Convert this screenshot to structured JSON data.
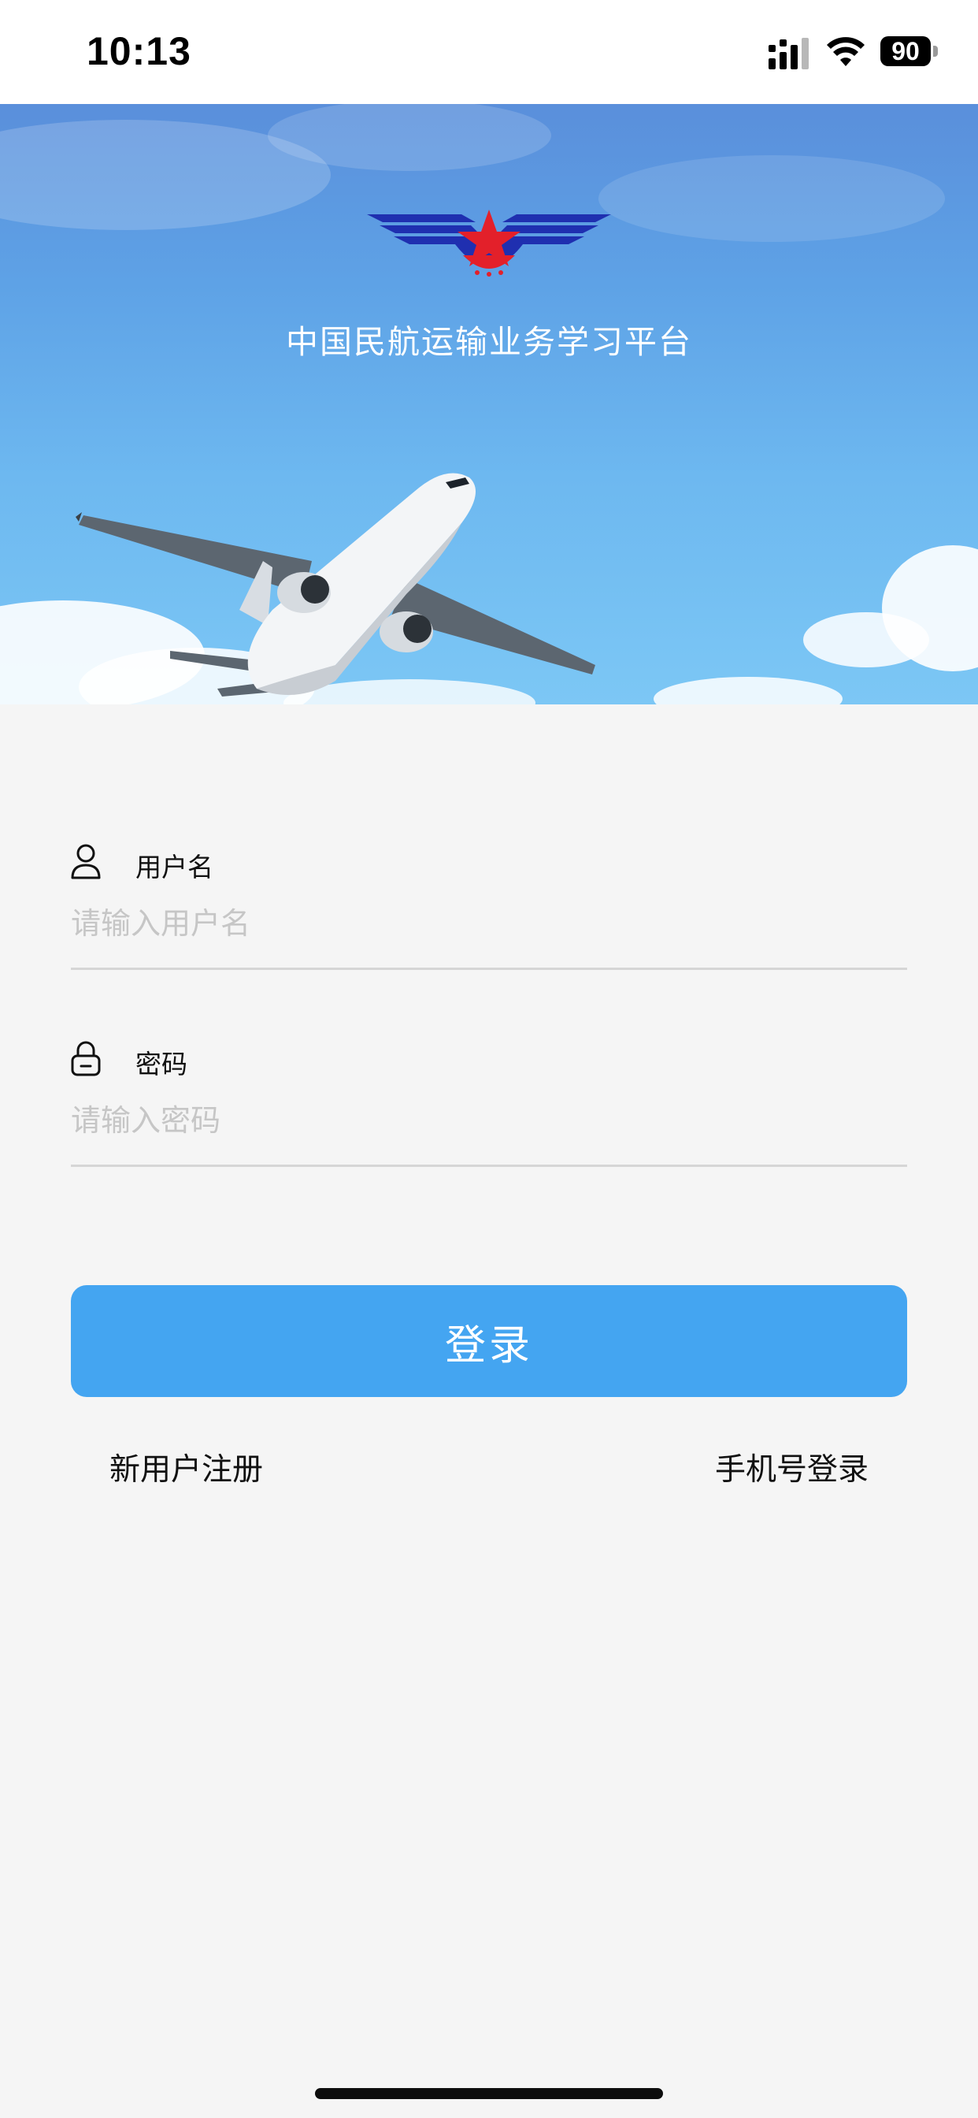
{
  "status_bar": {
    "time": "10:13",
    "battery": "90",
    "icons": [
      "signal-icon",
      "wifi-icon",
      "battery-icon"
    ]
  },
  "hero": {
    "title": "中国民航运输业务学习平台",
    "logo": "civil-aviation-wings-star-logo",
    "image": "airplane-in-blue-sky"
  },
  "form": {
    "username": {
      "icon": "user-icon",
      "label": "用户名",
      "placeholder": "请输入用户名",
      "value": ""
    },
    "password": {
      "icon": "lock-icon",
      "label": "密码",
      "placeholder": "请输入密码",
      "value": ""
    }
  },
  "actions": {
    "login_label": "登录",
    "register_label": "新用户注册",
    "phone_login_label": "手机号登录"
  },
  "colors": {
    "primary": "#44a5f1",
    "background": "#f5f5f5",
    "placeholder": "#c6c6c6",
    "divider": "#d6d6d6"
  }
}
